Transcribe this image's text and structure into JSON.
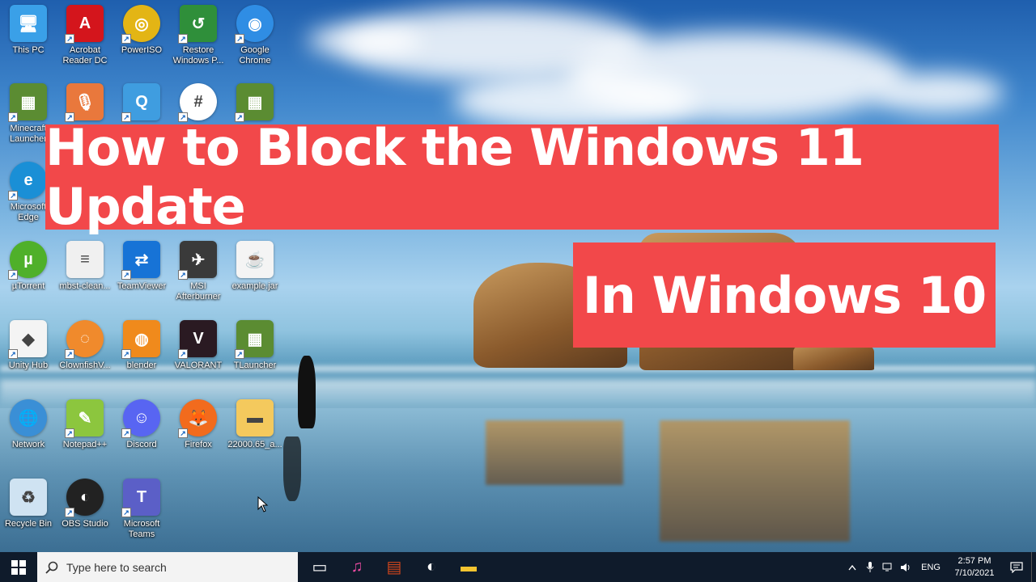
{
  "title_main": "How to Block the Windows 11 Update",
  "title_sub": "In Windows 10",
  "colors": {
    "banner": "#f2484a",
    "taskbar": "#0f1b2b",
    "search_box": "#f3f3f3"
  },
  "desktop_icons": [
    {
      "name": "this-pc",
      "label": "This PC",
      "icon": "computer-icon",
      "color": "#3aa0e8"
    },
    {
      "name": "acrobat",
      "label": "Acrobat Reader DC",
      "icon": "acrobat-icon",
      "color": "#d4151c"
    },
    {
      "name": "poweriso",
      "label": "PowerISO",
      "icon": "disc-icon",
      "color": "#e3b515"
    },
    {
      "name": "restore",
      "label": "Restore Windows P...",
      "icon": "restore-icon",
      "color": "#2f8f3a"
    },
    {
      "name": "chrome",
      "label": "Google Chrome",
      "icon": "chrome-icon",
      "color": "#2f8de4"
    },
    {
      "name": "minecraft",
      "label": "Minecraft Launcher",
      "icon": "minecraft-icon",
      "color": "#5b8c32"
    },
    {
      "name": "recorder",
      "label": "",
      "icon": "microphone-icon",
      "color": "#e9783c"
    },
    {
      "name": "quicktime",
      "label": "",
      "icon": "quicktime-icon",
      "color": "#3f9de0"
    },
    {
      "name": "slack",
      "label": "",
      "icon": "slack-icon",
      "color": "#ffffff"
    },
    {
      "name": "tlauncher-top",
      "label": "",
      "icon": "minecraft-icon",
      "color": "#5b8c32"
    },
    {
      "name": "edge",
      "label": "Microsoft Edge",
      "icon": "edge-icon",
      "color": "#1a8fd6"
    },
    {
      "name": "utorrent",
      "label": "µTorrent",
      "icon": "utorrent-icon",
      "color": "#4fb02a"
    },
    {
      "name": "mbst",
      "label": "mbst-clean...",
      "icon": "document-icon",
      "color": "#f0f0f0"
    },
    {
      "name": "teamviewer",
      "label": "TeamViewer",
      "icon": "teamviewer-icon",
      "color": "#1773d6"
    },
    {
      "name": "msi",
      "label": "MSI Afterburner",
      "icon": "afterburner-icon",
      "color": "#3a3a3a"
    },
    {
      "name": "examplejar",
      "label": "example.jar",
      "icon": "java-icon",
      "color": "#f4f4f4"
    },
    {
      "name": "unityhub",
      "label": "Unity Hub",
      "icon": "unity-icon",
      "color": "#f4f4f4"
    },
    {
      "name": "clownfish",
      "label": "ClownfishV...",
      "icon": "clownfish-icon",
      "color": "#f08a2c"
    },
    {
      "name": "blender",
      "label": "blender",
      "icon": "blender-icon",
      "color": "#f08a1c"
    },
    {
      "name": "valorant",
      "label": "VALORANT",
      "icon": "valorant-icon",
      "color": "#2a1a22"
    },
    {
      "name": "tlauncher",
      "label": "TLauncher",
      "icon": "minecraft-icon",
      "color": "#5b8c32"
    },
    {
      "name": "network",
      "label": "Network",
      "icon": "network-icon",
      "color": "#3a8fd6"
    },
    {
      "name": "notepadpp",
      "label": "Notepad++",
      "icon": "notepad-icon",
      "color": "#8cc63e"
    },
    {
      "name": "discord",
      "label": "Discord",
      "icon": "discord-icon",
      "color": "#5865f2"
    },
    {
      "name": "firefox",
      "label": "Firefox",
      "icon": "firefox-icon",
      "color": "#f26b1d"
    },
    {
      "name": "folder",
      "label": "22000.65_a...",
      "icon": "folder-icon",
      "color": "#f4c95d"
    },
    {
      "name": "recyclebin",
      "label": "Recycle Bin",
      "icon": "recycle-bin-icon",
      "color": "#cfe3f2"
    },
    {
      "name": "obs",
      "label": "OBS Studio",
      "icon": "obs-icon",
      "color": "#222222"
    },
    {
      "name": "teams",
      "label": "Microsoft Teams",
      "icon": "teams-icon",
      "color": "#5b5fc7"
    }
  ],
  "taskbar": {
    "search_placeholder": "Type here to search",
    "apps": [
      {
        "name": "task-view",
        "icon": "task-view-icon"
      },
      {
        "name": "itunes",
        "icon": "itunes-icon",
        "color": "#e84aa0"
      },
      {
        "name": "film-app",
        "icon": "film-icon",
        "color": "#d0451b"
      },
      {
        "name": "obs-taskbar",
        "icon": "obs-icon",
        "color": "#ffffff"
      },
      {
        "name": "file-explorer",
        "icon": "folder-icon",
        "color": "#f4c430"
      }
    ],
    "language": "ENG",
    "time": "2:57 PM",
    "date": "7/10/2021"
  }
}
